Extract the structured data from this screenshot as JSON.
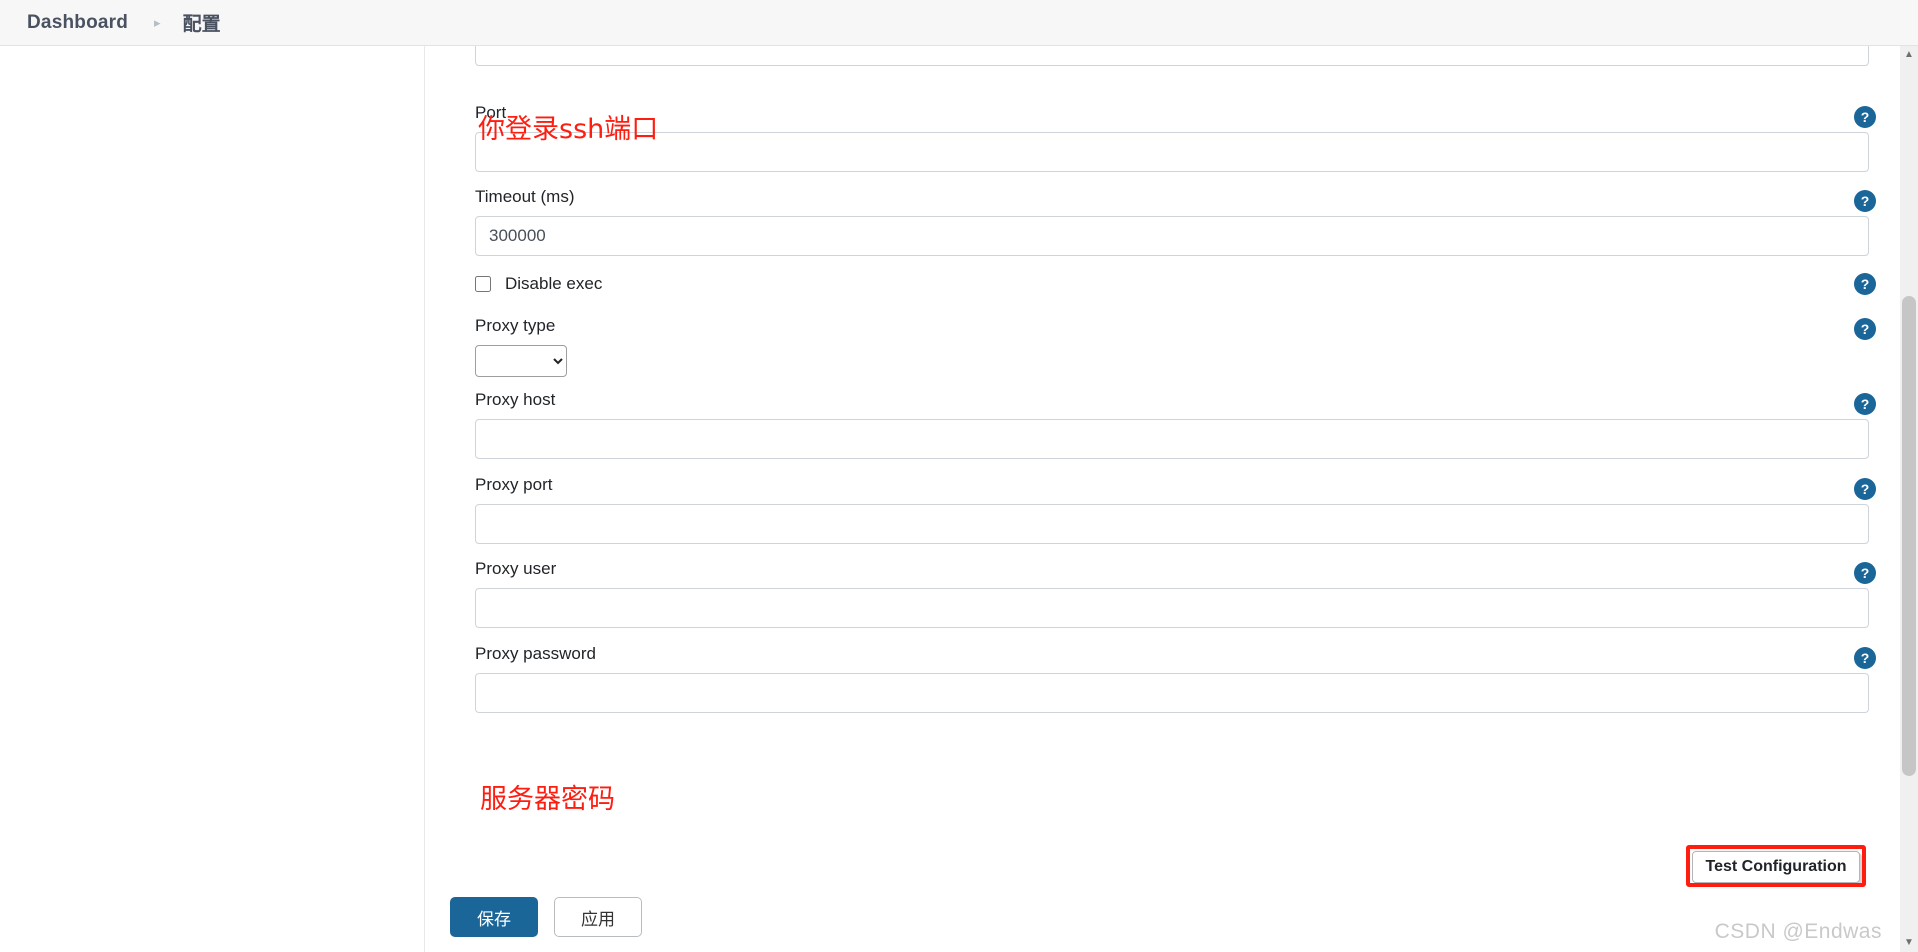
{
  "breadcrumb": {
    "home": "Dashboard",
    "separator": "▸",
    "current": "配置"
  },
  "colors": {
    "accent": "#1a6699",
    "help_icon_bg": "#1a6699",
    "annotation_red": "#ff1d10",
    "input_border": "#ced4da",
    "topbar_bg": "#f7f7f7"
  },
  "form": {
    "help_icon_glyph": "?",
    "fields": [
      {
        "key": "port",
        "label": "Port",
        "value": "",
        "placeholder": "",
        "type": "text",
        "has_help": true
      },
      {
        "key": "timeout",
        "label": "Timeout (ms)",
        "value": "300000",
        "placeholder": "",
        "type": "text",
        "has_help": true
      },
      {
        "key": "disable_exec",
        "label": "Disable exec",
        "value": "",
        "checked": false,
        "type": "checkbox",
        "has_help": true
      },
      {
        "key": "proxy_type",
        "label": "Proxy type",
        "value": "",
        "type": "select",
        "options": [
          ""
        ],
        "has_help": true
      },
      {
        "key": "proxy_host",
        "label": "Proxy host",
        "value": "",
        "placeholder": "",
        "type": "text",
        "has_help": true
      },
      {
        "key": "proxy_port",
        "label": "Proxy port",
        "value": "",
        "placeholder": "",
        "type": "text",
        "has_help": true
      },
      {
        "key": "proxy_user",
        "label": "Proxy user",
        "value": "",
        "placeholder": "",
        "type": "text",
        "has_help": true
      },
      {
        "key": "proxy_password",
        "label": "Proxy password",
        "value": "",
        "placeholder": "",
        "type": "password",
        "has_help": true
      }
    ]
  },
  "annotations": {
    "port_note": "你登录ssh端口",
    "proxy_password_note": "服务器密码"
  },
  "actions": {
    "test_configuration": "Test Configuration",
    "save": "保存",
    "apply": "应用"
  },
  "scrollbar": {
    "up_arrow": "▲",
    "down_arrow": "▼"
  },
  "watermark": "CSDN @Endwas"
}
